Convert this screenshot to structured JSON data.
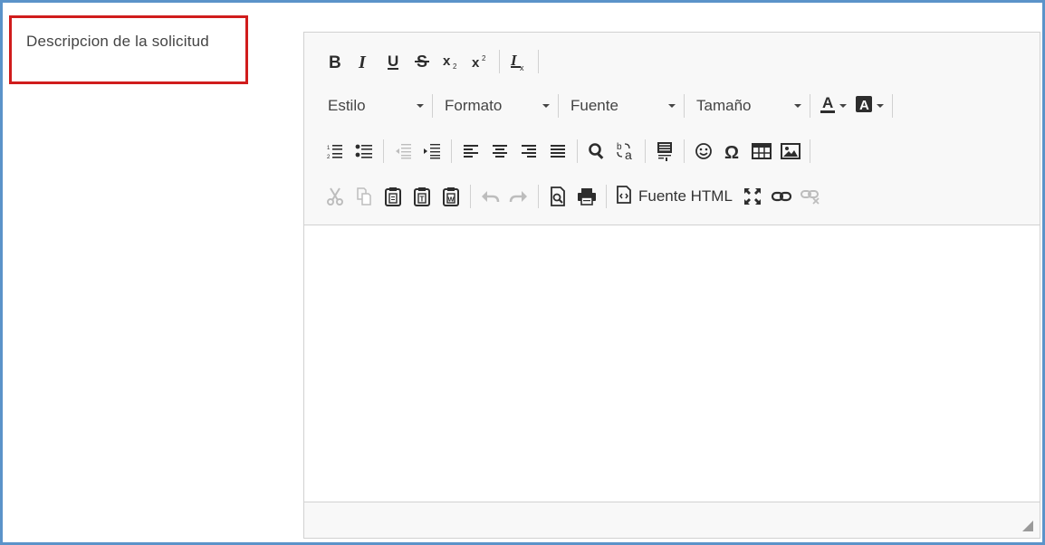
{
  "field": {
    "label": "Descripcion de la solicitud"
  },
  "toolbar": {
    "row1": {
      "icons": [
        "bold-icon",
        "italic-icon",
        "underline-icon",
        "strikethrough-icon",
        "subscript-icon",
        "superscript-icon",
        "remove-format-icon"
      ]
    },
    "row2": {
      "style_combo": "Estilo",
      "format_combo": "Formato",
      "font_combo": "Fuente",
      "size_combo": "Tamaño",
      "text_color_icon": "text-color-icon",
      "bg_color_icon": "background-color-icon"
    },
    "row3": {
      "icons": [
        "numbered-list-icon",
        "bulleted-list-icon",
        "outdent-icon",
        "indent-icon",
        "align-left-icon",
        "align-center-icon",
        "align-right-icon",
        "justify-icon",
        "find-icon",
        "replace-icon",
        "show-blocks-icon",
        "smiley-icon",
        "special-char-icon",
        "table-icon",
        "image-icon"
      ]
    },
    "row4": {
      "icons": [
        "cut-icon",
        "copy-icon",
        "paste-icon",
        "paste-text-icon",
        "paste-word-icon",
        "undo-icon",
        "redo-icon",
        "preview-icon",
        "print-icon",
        "source-icon",
        "maximize-icon",
        "link-icon",
        "unlink-icon"
      ],
      "source_label": "Fuente HTML"
    }
  },
  "colors": {
    "frame_border": "#5b93c9",
    "highlight_border": "#d01c1c",
    "toolbar_bg": "#f8f8f8",
    "disabled_icon": "#bdbdbd"
  }
}
